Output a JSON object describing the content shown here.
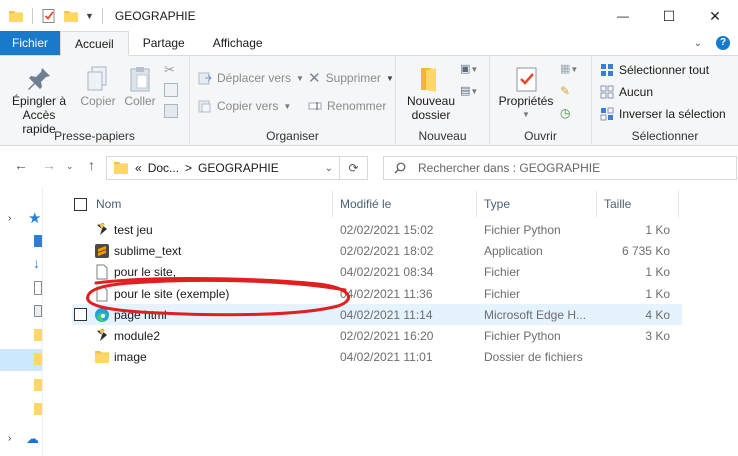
{
  "window": {
    "title": "GEOGRAPHIE",
    "minimize_glyph": "—",
    "maximize_glyph": "☐",
    "close_glyph": "✕"
  },
  "ribbon_tabs": [
    {
      "label": "Fichier"
    },
    {
      "label": "Accueil"
    },
    {
      "label": "Partage"
    },
    {
      "label": "Affichage"
    }
  ],
  "ribbon": {
    "clipboard": {
      "pin_label_1": "Épingler à",
      "pin_label_2": "Accès rapide",
      "copy_label": "Copier",
      "paste_label": "Coller",
      "group_label": "Presse-papiers"
    },
    "organize": {
      "move_label": "Déplacer vers",
      "copy_to_label": "Copier vers",
      "delete_label": "Supprimer",
      "rename_label": "Renommer",
      "group_label": "Organiser"
    },
    "new": {
      "new_folder_1": "Nouveau",
      "new_folder_2": "dossier",
      "group_label": "Nouveau"
    },
    "open": {
      "properties_label": "Propriétés",
      "group_label": "Ouvrir"
    },
    "select": {
      "select_all": "Sélectionner tout",
      "select_none": "Aucun",
      "invert": "Inverser la sélection",
      "group_label": "Sélectionner"
    }
  },
  "address": {
    "overflow": "«",
    "crumb_1": "Doc...",
    "crumb_sep": ">",
    "crumb_2": "GEOGRAPHIE",
    "search_placeholder": "Rechercher dans : GEOGRAPHIE"
  },
  "columns": {
    "name": "Nom",
    "modified": "Modifié le",
    "type": "Type",
    "size": "Taille"
  },
  "files": [
    {
      "name": "test jeu",
      "modified": "02/02/2021 15:02",
      "type": "Fichier Python",
      "size": "1 Ko",
      "icon": "python-icon"
    },
    {
      "name": "sublime_text",
      "modified": "02/02/2021 18:02",
      "type": "Application",
      "size": "6 735 Ko",
      "icon": "sublime-icon"
    },
    {
      "name": "pour le site,",
      "modified": "04/02/2021 08:34",
      "type": "Fichier",
      "size": "1 Ko",
      "icon": "file-icon"
    },
    {
      "name": "pour le site (exemple)",
      "modified": "04/02/2021 11:36",
      "type": "Fichier",
      "size": "1 Ko",
      "icon": "file-icon"
    },
    {
      "name": "page html",
      "modified": "04/02/2021 11:14",
      "type": "Microsoft Edge H...",
      "size": "4 Ko",
      "icon": "edge-icon"
    },
    {
      "name": "module2",
      "modified": "02/02/2021 16:20",
      "type": "Fichier Python",
      "size": "3 Ko",
      "icon": "python-icon"
    },
    {
      "name": "image",
      "modified": "04/02/2021 11:01",
      "type": "Dossier de fichiers",
      "size": "",
      "icon": "folder-icon"
    }
  ],
  "colors": {
    "file_tab": "#1979ca",
    "hover_row": "#e5f3ff",
    "annotation": "#e02020"
  }
}
